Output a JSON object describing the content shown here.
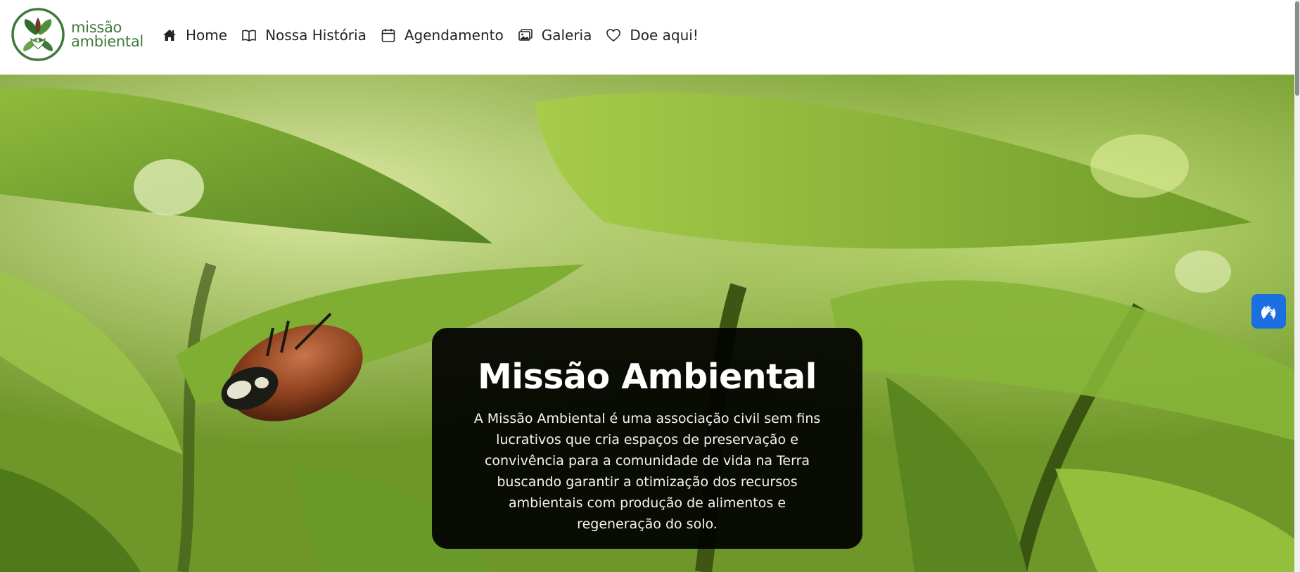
{
  "brand": {
    "line1": "missão",
    "line2": "ambiental"
  },
  "nav": {
    "items": [
      {
        "label": "Home",
        "icon": "house-icon"
      },
      {
        "label": "Nossa História",
        "icon": "book-icon"
      },
      {
        "label": "Agendamento",
        "icon": "calendar-icon"
      },
      {
        "label": "Galeria",
        "icon": "images-icon"
      },
      {
        "label": "Doe aqui!",
        "icon": "heart-icon"
      }
    ]
  },
  "hero": {
    "title": "Missão Ambiental",
    "description": "A Missão Ambiental é uma associação civil sem fins lucrativos que cria espaços de preservação e convivência para a comunidade de vida na Terra buscando garantir a otimização dos recursos ambientais com produção de alimentos e regeneração do solo."
  },
  "accessibility": {
    "icon": "sign-language-hands-icon"
  },
  "colors": {
    "brand_green": "#3f7a3c",
    "accessibility_blue": "#1c6fe0",
    "card_bg": "#000000"
  }
}
